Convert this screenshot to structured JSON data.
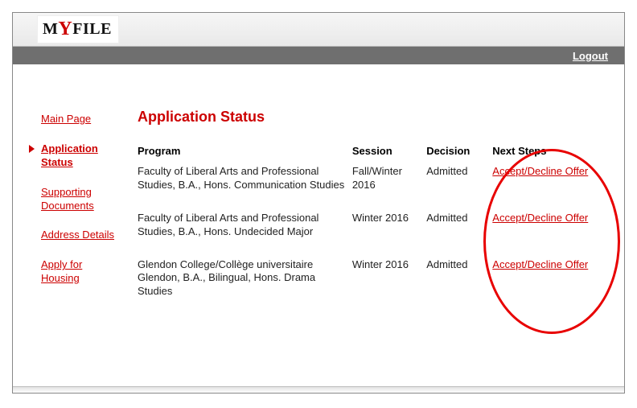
{
  "logo": {
    "pre": "M",
    "y": "Y",
    "post": "FILE"
  },
  "header": {
    "logout": "Logout"
  },
  "sidebar": {
    "items": [
      {
        "label": "Main Page",
        "active": false
      },
      {
        "label": "Application Status",
        "active": true
      },
      {
        "label": "Supporting Documents",
        "active": false
      },
      {
        "label": "Address Details",
        "active": false
      },
      {
        "label": "Apply for Housing",
        "active": false
      }
    ]
  },
  "main": {
    "title": "Application Status",
    "columns": {
      "program": "Program",
      "session": "Session",
      "decision": "Decision",
      "next": "Next Steps"
    },
    "rows": [
      {
        "program": "Faculty of Liberal Arts and Professional Studies, B.A., Hons. Communication Studies",
        "session": "Fall/Winter 2016",
        "decision": "Admitted",
        "next": "Accept/Decline Offer"
      },
      {
        "program": "Faculty of Liberal Arts and Professional Studies, B.A., Hons. Undecided Major",
        "session": "Winter 2016",
        "decision": "Admitted",
        "next": "Accept/Decline Offer"
      },
      {
        "program": "Glendon College/Collège universitaire Glendon, B.A., Bilingual, Hons. Drama Studies",
        "session": "Winter 2016",
        "decision": "Admitted",
        "next": "Accept/Decline Offer"
      }
    ]
  }
}
